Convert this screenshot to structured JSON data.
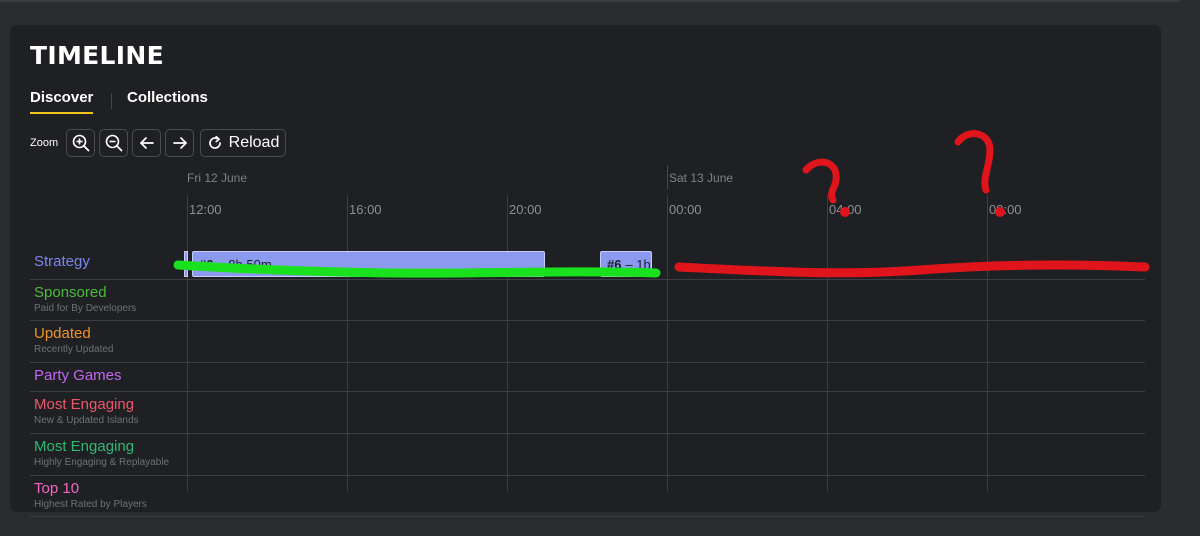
{
  "header": {
    "title": "TIMELINE"
  },
  "tabs": [
    {
      "label": "Discover",
      "active": true
    },
    {
      "label": "Collections",
      "active": false
    }
  ],
  "toolbar": {
    "zoom_label": "Zoom",
    "zoom_in_icon": "zoom-in-icon",
    "zoom_out_icon": "zoom-out-icon",
    "back_icon": "arrow-left-icon",
    "forward_icon": "arrow-right-icon",
    "reload_icon": "reload-icon",
    "reload_label": "Reload"
  },
  "timeline": {
    "days": [
      "Fri 12 June",
      "Sat 13 June"
    ],
    "hours": [
      "12:00",
      "16:00",
      "20:00",
      "00:00",
      "04:00",
      "08:00"
    ],
    "rows": [
      {
        "name": "Strategy",
        "sub": "",
        "color": "#7b86ee"
      },
      {
        "name": "Sponsored",
        "sub": "Paid for By Developers",
        "color": "#4cbb3c"
      },
      {
        "name": "Updated",
        "sub": "Recently Updated",
        "color": "#f0922a"
      },
      {
        "name": "Party Games",
        "sub": "",
        "color": "#c167f2"
      },
      {
        "name": "Most Engaging",
        "sub": "New & Updated Islands",
        "color": "#f0566a"
      },
      {
        "name": "Most Engaging",
        "sub": "Highly Engaging & Replayable",
        "color": "#2fb974"
      },
      {
        "name": "Top 10",
        "sub": "Highest Rated by Players",
        "color": "#f067c6"
      }
    ],
    "bars": [
      {
        "rank": "#6",
        "duration": "– 8h 50m"
      },
      {
        "rank": "#6",
        "duration": "– 1h"
      }
    ]
  },
  "colors": {
    "background": "#2b2c30",
    "panel": "#1f2023",
    "tab_underline": "#f0c419",
    "bar_fill": "#8b99ee",
    "annotation_green": "#19e11d",
    "annotation_red": "#e0141b"
  }
}
